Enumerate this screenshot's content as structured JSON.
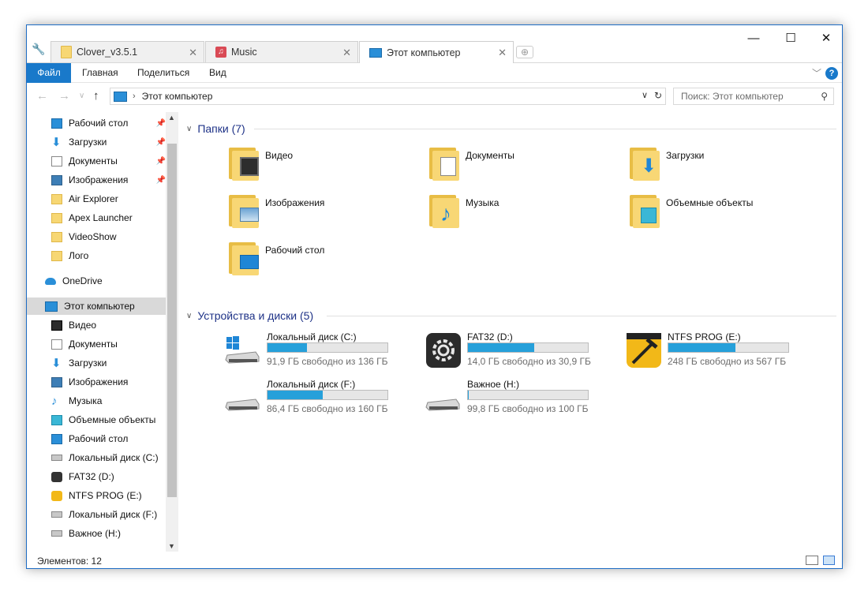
{
  "tabs": [
    {
      "label": "Clover_v3.5.1",
      "icon": "folder-icon"
    },
    {
      "label": "Music",
      "icon": "music-icon"
    },
    {
      "label": "Этот компьютер",
      "icon": "computer-icon"
    }
  ],
  "window_controls": {
    "minimize": "—",
    "maximize": "☐",
    "close": "✕"
  },
  "ribbon": {
    "file": "Файл",
    "items": [
      "Главная",
      "Поделиться",
      "Вид"
    ]
  },
  "address": {
    "crumb": "Этот компьютер",
    "search_placeholder": "Поиск: Этот компьютер"
  },
  "sidebar": {
    "items": [
      {
        "label": "Рабочий стол",
        "icon": "desktop-icon",
        "pinned": true
      },
      {
        "label": "Загрузки",
        "icon": "downloads-icon",
        "pinned": true
      },
      {
        "label": "Документы",
        "icon": "documents-icon",
        "pinned": true
      },
      {
        "label": "Изображения",
        "icon": "pictures-icon",
        "pinned": true
      },
      {
        "label": "Air Explorer",
        "icon": "folder-icon",
        "pinned": false
      },
      {
        "label": "Apex Launcher",
        "icon": "folder-icon",
        "pinned": false
      },
      {
        "label": "VideoShow",
        "icon": "folder-icon",
        "pinned": false
      },
      {
        "label": "Лого",
        "icon": "folder-icon",
        "pinned": false
      },
      {
        "label": "OneDrive",
        "icon": "onedrive-icon",
        "pinned": false
      },
      {
        "label": "Этот компьютер",
        "icon": "computer-icon",
        "pinned": false
      },
      {
        "label": "Видео",
        "icon": "video-icon",
        "pinned": false
      },
      {
        "label": "Документы",
        "icon": "documents-icon",
        "pinned": false
      },
      {
        "label": "Загрузки",
        "icon": "downloads-icon",
        "pinned": false
      },
      {
        "label": "Изображения",
        "icon": "pictures-icon",
        "pinned": false
      },
      {
        "label": "Музыка",
        "icon": "music-note-icon",
        "pinned": false
      },
      {
        "label": "Объемные объекты",
        "icon": "3d-objects-icon",
        "pinned": false
      },
      {
        "label": "Рабочий стол",
        "icon": "desktop-icon",
        "pinned": false
      },
      {
        "label": "Локальный диск (C:)",
        "icon": "drive-icon",
        "pinned": false
      },
      {
        "label": "FAT32 (D:)",
        "icon": "gear-drive-icon",
        "pinned": false
      },
      {
        "label": "NTFS PROG (E:)",
        "icon": "tools-drive-icon",
        "pinned": false
      },
      {
        "label": "Локальный диск (F:)",
        "icon": "drive-icon",
        "pinned": false
      },
      {
        "label": "Важное (H:)",
        "icon": "drive-icon",
        "pinned": false
      }
    ]
  },
  "folders_group": {
    "title": "Папки (7)",
    "items": [
      {
        "label": "Видео",
        "icon": "video-folder-icon"
      },
      {
        "label": "Документы",
        "icon": "documents-folder-icon"
      },
      {
        "label": "Загрузки",
        "icon": "downloads-folder-icon"
      },
      {
        "label": "Изображения",
        "icon": "pictures-folder-icon"
      },
      {
        "label": "Музыка",
        "icon": "music-folder-icon"
      },
      {
        "label": "Объемные объекты",
        "icon": "3d-objects-folder-icon"
      },
      {
        "label": "Рабочий стол",
        "icon": "desktop-folder-icon"
      }
    ]
  },
  "drives_group": {
    "title": "Устройства и диски (5)",
    "items": [
      {
        "name": "Локальный диск (C:)",
        "free": "91,9 ГБ свободно из 136 ГБ",
        "used_fraction": 0.33,
        "icon": "windows-drive-icon"
      },
      {
        "name": "FAT32 (D:)",
        "free": "14,0 ГБ свободно из 30,9 ГБ",
        "used_fraction": 0.55,
        "icon": "gear-drive-icon"
      },
      {
        "name": "NTFS PROG (E:)",
        "free": "248 ГБ свободно из 567 ГБ",
        "used_fraction": 0.56,
        "icon": "tools-drive-icon"
      },
      {
        "name": "Локальный диск (F:)",
        "free": "86,4 ГБ свободно из 160 ГБ",
        "used_fraction": 0.46,
        "icon": "drive-icon"
      },
      {
        "name": "Важное (H:)",
        "free": "99,8 ГБ свободно из 100 ГБ",
        "used_fraction": 0.002,
        "icon": "drive-icon"
      }
    ]
  },
  "status": {
    "items_count": "Элементов: 12"
  },
  "colors": {
    "accent": "#1979ca",
    "bar_fill": "#26a0da",
    "group_title": "#1e3287"
  }
}
